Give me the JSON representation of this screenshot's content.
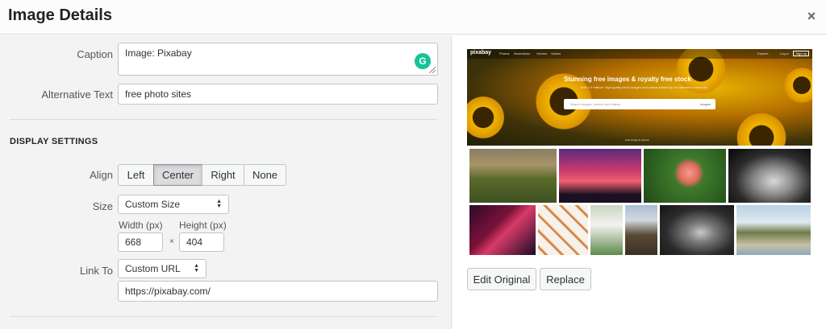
{
  "header": {
    "title": "Image Details",
    "close_icon": "×"
  },
  "form": {
    "caption_label": "Caption",
    "caption_value": "Image: Pixabay",
    "alt_label": "Alternative Text",
    "alt_value": "free photo sites"
  },
  "display": {
    "section_title": "DISPLAY SETTINGS",
    "align_label": "Align",
    "align_options": [
      "Left",
      "Center",
      "Right",
      "None"
    ],
    "align_selected": "Center",
    "size_label": "Size",
    "size_value": "Custom Size",
    "width_label": "Width (px)",
    "height_label": "Height (px)",
    "width_value": "668",
    "height_value": "404",
    "times": "×",
    "link_label": "Link To",
    "link_value": "Custom URL",
    "url_value": "https://pixabay.com/"
  },
  "preview": {
    "logo": "pixabay",
    "nav": [
      "Photos",
      "Illustrations",
      "Vectors",
      "Videos"
    ],
    "nav_right": [
      "Explore",
      "Log in"
    ],
    "signup": "Sign up",
    "headline": "Stunning free images & royalty free stock",
    "subheadline": "Over 1.9 million+ high quality stock images and videos shared by our talented community.",
    "search_placeholder": "Search images, vectors and videos",
    "search_type": "Images",
    "credit": "Free image by Quince"
  },
  "actions": {
    "edit_original": "Edit Original",
    "replace": "Replace"
  },
  "colors": {
    "grammarly": "#15c39a",
    "panel_bg": "#f3f3f3"
  }
}
